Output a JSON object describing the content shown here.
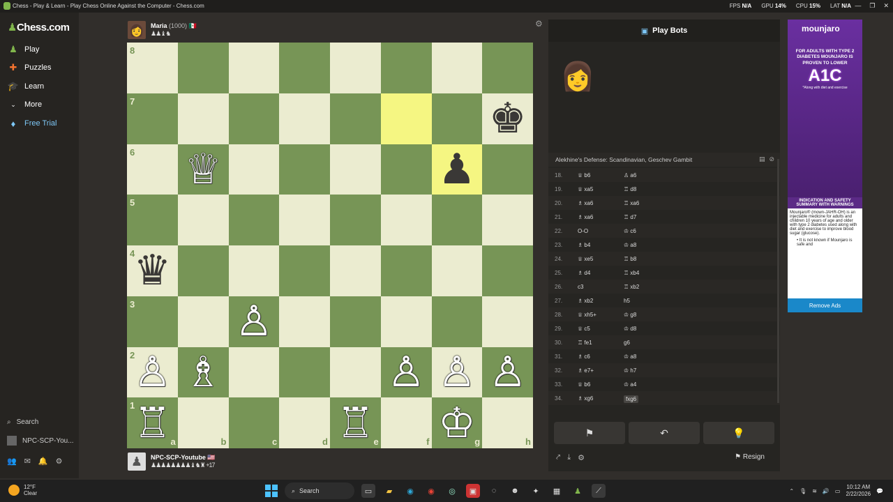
{
  "window": {
    "title": "Chess - Play & Learn - Play Chess Online Against the Computer - Chess.com"
  },
  "stats": {
    "fps_label": "FPS",
    "fps": "N/A",
    "gpu_label": "GPU",
    "gpu": "14%",
    "cpu_label": "CPU",
    "cpu": "15%",
    "lat_label": "LAT",
    "lat": "N/A"
  },
  "sidebar": {
    "brand": "Chess.com",
    "items": [
      {
        "label": "Play",
        "icon": "pawn-icon"
      },
      {
        "label": "Puzzles",
        "icon": "puzzle-icon"
      },
      {
        "label": "Learn",
        "icon": "graduation-cap-icon"
      },
      {
        "label": "More",
        "icon": "chevron-down-icon"
      },
      {
        "label": "Free Trial",
        "icon": "diamond-icon"
      }
    ],
    "search_label": "Search",
    "user_label": "NPC-SCP-You..."
  },
  "opponent": {
    "name": "Maria",
    "rating": "(1000)",
    "captured": "♟♟♝♞"
  },
  "player": {
    "name": "NPC-SCP-Youtube",
    "captured": "♟♟♟♟♟♟♟♟♝♞♜",
    "advantage": "+17"
  },
  "board": {
    "ranks": [
      "8",
      "7",
      "6",
      "5",
      "4",
      "3",
      "2",
      "1"
    ],
    "files": [
      "a",
      "b",
      "c",
      "d",
      "e",
      "f",
      "g",
      "h"
    ],
    "highlighted": [
      "f7",
      "g6"
    ],
    "pieces": {
      "h7": "♚",
      "b6": "♕",
      "g6": "♟",
      "a4": "♛",
      "c3": "♙",
      "a2": "♙",
      "b2": "♗",
      "f2": "♙",
      "g2": "♙",
      "h2": "♙",
      "a1": "♖",
      "e1": "♖",
      "g1": "♔"
    },
    "colors": {
      "h7": "b",
      "g6": "b",
      "a4": "b",
      "b6": "w",
      "c3": "w",
      "a2": "w",
      "b2": "w",
      "f2": "w",
      "g2": "w",
      "h2": "w",
      "a1": "w",
      "e1": "w",
      "g1": "w"
    }
  },
  "panel": {
    "title": "Play Bots",
    "opening": "Alekhine's Defense: Scandinavian, Geschev Gambit",
    "moves": [
      {
        "n": "18.",
        "w": "♕ b6",
        "b": "♙ a6"
      },
      {
        "n": "19.",
        "w": "♕ xa5",
        "b": "♖ d8"
      },
      {
        "n": "20.",
        "w": "♗ xa6",
        "b": "♖ xa6"
      },
      {
        "n": "21.",
        "w": "♗ xa6",
        "b": "♖ d7"
      },
      {
        "n": "22.",
        "w": "O-O",
        "b": "♔ c6"
      },
      {
        "n": "23.",
        "w": "♗ b4",
        "b": "♔ a8"
      },
      {
        "n": "24.",
        "w": "♕ xe5",
        "b": "♖ b8"
      },
      {
        "n": "25.",
        "w": "♗ d4",
        "b": "♖ xb4"
      },
      {
        "n": "26.",
        "w": "c3",
        "b": "♖ xb2"
      },
      {
        "n": "27.",
        "w": "♗ xb2",
        "b": "h5"
      },
      {
        "n": "28.",
        "w": "♕ xh5+",
        "b": "♔ g8"
      },
      {
        "n": "29.",
        "w": "♕ c5",
        "b": "♔ d8"
      },
      {
        "n": "30.",
        "w": "♖ fe1",
        "b": "g6"
      },
      {
        "n": "31.",
        "w": "♗ c6",
        "b": "♔ a8"
      },
      {
        "n": "32.",
        "w": "♗ e7+",
        "b": "♔ h7"
      },
      {
        "n": "33.",
        "w": "♕ b6",
        "b": "♔ a4"
      },
      {
        "n": "34.",
        "w": "♗ xg6",
        "b": "fxg6"
      }
    ],
    "resign": "Resign"
  },
  "ad": {
    "brand": "mounjaro",
    "headline": "FOR ADULTS WITH TYPE 2 DIABETES MOUNJARO IS PROVEN TO LOWER",
    "big": "A1C",
    "sub": "*Along with diet and exercise",
    "info_title": "INDICATION AND SAFETY SUMMARY WITH WARNINGS",
    "info_text": "Mounjaro® (mown-JAHR-OH) is an injectable medicine for adults and children 10 years of age and older with type 2 diabetes used along with diet and exercise to improve blood sugar (glucose).",
    "bullet": "It is not known if Mounjaro is safe and",
    "remove": "Remove Ads"
  },
  "taskbar": {
    "temp": "12°F",
    "weather": "Clear",
    "search": "Search",
    "time": "10:12 AM",
    "date": "2/22/2026"
  }
}
